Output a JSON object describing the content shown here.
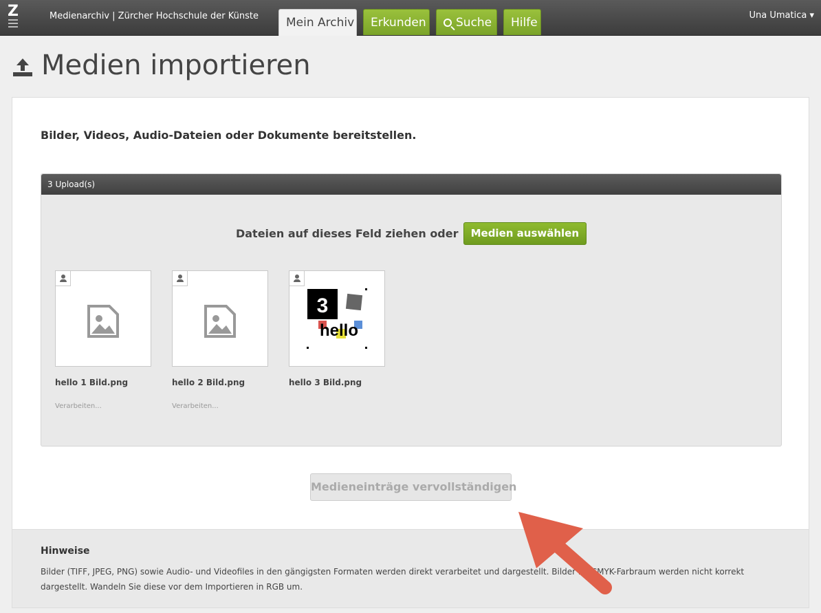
{
  "header": {
    "logo_letter": "Z",
    "site_title": "Medienarchiv | Zürcher Hochschule der Künste",
    "tabs": [
      {
        "label": "Mein Archiv",
        "active": true
      },
      {
        "label": "Erkunden",
        "active": false
      },
      {
        "label": "Suche",
        "icon": "search-icon",
        "active": false
      },
      {
        "label": "Hilfe",
        "active": false
      }
    ],
    "user_name": "Una Umatica",
    "user_caret": "▾"
  },
  "page": {
    "title": "Medien importieren",
    "title_icon": "upload-icon"
  },
  "main": {
    "intro": "Bilder, Videos, Audio-Dateien oder Dokumente bereitstellen.",
    "upload_header": "3 Upload(s)",
    "drop_text": "Dateien auf dieses Feld ziehen oder",
    "select_button": "Medien auswählen",
    "files": [
      {
        "name": "hello 1 Bild.png",
        "status": "Verarbeiten...",
        "thumbnail": "image-placeholder-icon"
      },
      {
        "name": "hello 2 Bild.png",
        "status": "Verarbeiten...",
        "thumbnail": "image-placeholder-icon"
      },
      {
        "name": "hello 3 Bild.png",
        "status": "",
        "thumbnail": "preview-image",
        "preview": {
          "number": "3",
          "word": "hello"
        }
      }
    ],
    "complete_button": "Medieneinträge vervollständigen"
  },
  "notes": {
    "title": "Hinweise",
    "text": "Bilder (TIFF, JPEG, PNG) sowie Audio- und Videofiles in den gängigsten Formaten werden direkt verarbeitet und dargestellt. Bilder im CMYK-Farbraum werden nicht korrekt dargestellt. Wandeln Sie diese vor dem Importieren in RGB um."
  },
  "colors": {
    "accent_green": "#7aa329",
    "annotation_arrow": "#e0604a",
    "topbar": "#444444"
  }
}
